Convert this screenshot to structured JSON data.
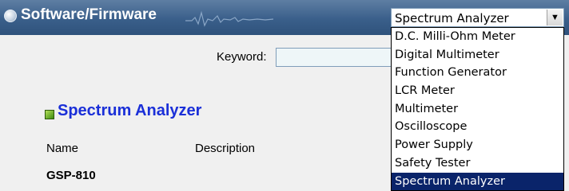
{
  "header": {
    "title": "Software/Firmware"
  },
  "search": {
    "keyword_label": "Keyword:",
    "keyword_value": ""
  },
  "section": {
    "title": "Spectrum Analyzer"
  },
  "table": {
    "headers": {
      "name": "Name",
      "description": "Description"
    },
    "rows": [
      {
        "name": "GSP-810",
        "description": ""
      }
    ]
  },
  "category_select": {
    "selected": "Spectrum Analyzer",
    "options": [
      "D.C. Milli-Ohm Meter",
      "Digital Multimeter",
      "Function Generator",
      "LCR Meter",
      "Multimeter",
      "Oscilloscope",
      "Power Supply",
      "Safety Tester",
      "Spectrum Analyzer"
    ]
  },
  "colors": {
    "header_blue": "#3a5f8a",
    "section_title": "#1a2fd8",
    "selection_highlight": "#0a246a"
  }
}
